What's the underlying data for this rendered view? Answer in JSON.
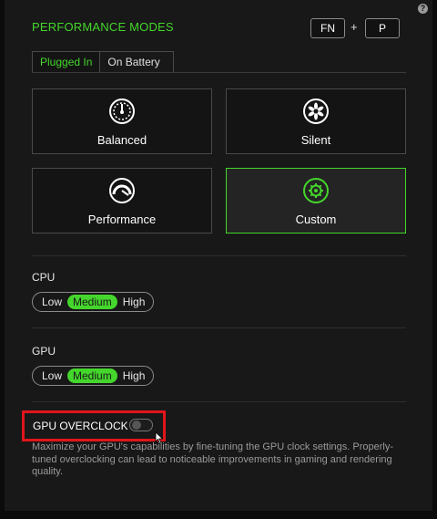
{
  "header": {
    "title": "PERFORMANCE MODES",
    "help_icon": "?",
    "shortcut": {
      "key1": "FN",
      "plus": "+",
      "key2": "P"
    }
  },
  "tabs": [
    {
      "label": "Plugged In",
      "active": true
    },
    {
      "label": "On Battery",
      "active": false
    }
  ],
  "modes": [
    {
      "label": "Balanced",
      "icon": "gauge-icon",
      "selected": false
    },
    {
      "label": "Silent",
      "icon": "fan-icon",
      "selected": false
    },
    {
      "label": "Performance",
      "icon": "speedometer-icon",
      "selected": false
    },
    {
      "label": "Custom",
      "icon": "gear-icon",
      "selected": true
    }
  ],
  "cpu": {
    "label": "CPU",
    "options": [
      "Low",
      "Medium",
      "High"
    ],
    "selected": "Medium"
  },
  "gpu": {
    "label": "GPU",
    "options": [
      "Low",
      "Medium",
      "High"
    ],
    "selected": "Medium"
  },
  "overclock": {
    "label": "GPU OVERCLOCK",
    "enabled": false,
    "description": "Maximize your GPU's capabilities by fine-tuning the GPU clock settings. Properly-tuned overclocking can lead to noticeable improvements in gaming and rendering quality."
  },
  "colors": {
    "accent": "#44d62c",
    "highlight": "#e0151b",
    "background": "#181818"
  }
}
